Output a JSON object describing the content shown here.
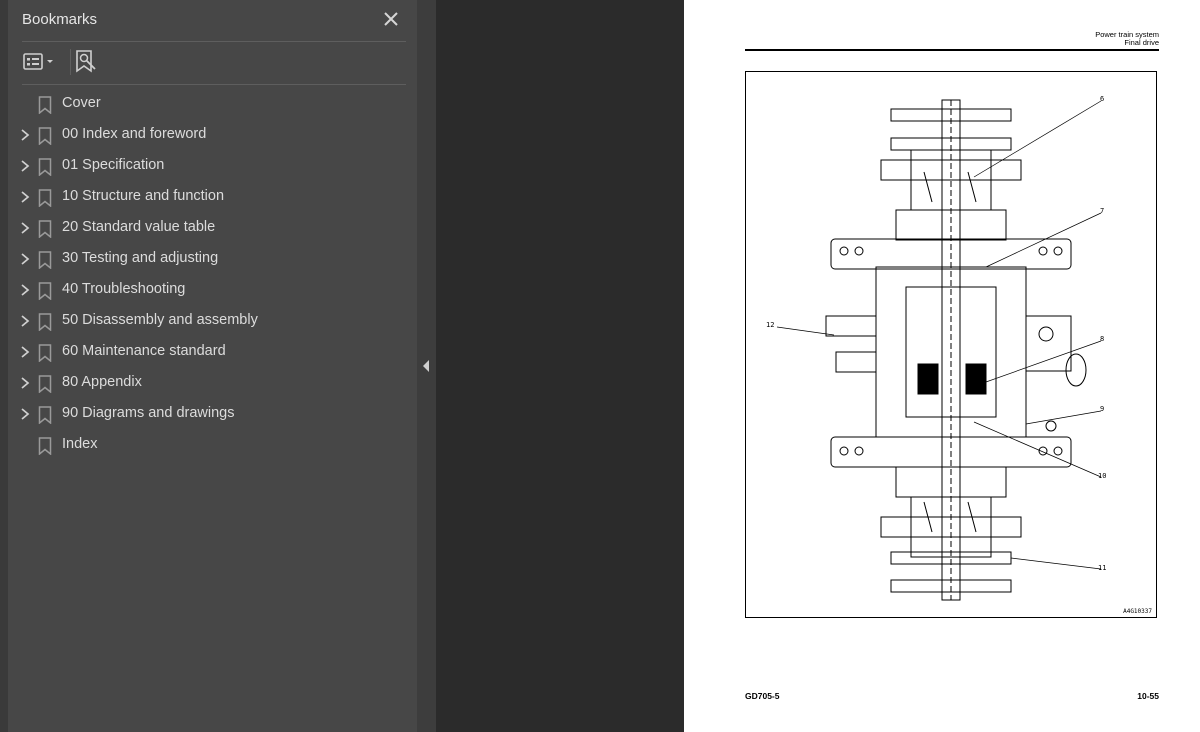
{
  "panel": {
    "title": "Bookmarks",
    "close_icon": "close-icon",
    "toolbar": [
      {
        "icon": "options-menu-icon"
      },
      {
        "icon": "find-bookmark-icon"
      }
    ]
  },
  "bookmarks": [
    {
      "label": "Cover",
      "expandable": false
    },
    {
      "label": "00 Index and foreword",
      "expandable": true
    },
    {
      "label": "01 Specification",
      "expandable": true
    },
    {
      "label": "10 Structure and function",
      "expandable": true
    },
    {
      "label": "20 Standard value table",
      "expandable": true
    },
    {
      "label": "30 Testing and adjusting",
      "expandable": true
    },
    {
      "label": "40 Troubleshooting",
      "expandable": true
    },
    {
      "label": "50 Disassembly and assembly",
      "expandable": true
    },
    {
      "label": "60 Maintenance standard",
      "expandable": true
    },
    {
      "label": "80 Appendix",
      "expandable": true
    },
    {
      "label": "90 Diagrams and drawings",
      "expandable": true
    },
    {
      "label": "Index",
      "expandable": false
    }
  ],
  "page": {
    "header_line1": "Power train system",
    "header_line2": "Final drive",
    "figure": {
      "callouts": [
        "6",
        "7",
        "12",
        "8",
        "9",
        "10",
        "11"
      ],
      "figure_id": "A4G10337"
    },
    "footer_left": "GD705-5",
    "footer_right": "10-55"
  },
  "colors": {
    "panel_bg": "#474747",
    "viewer_bg": "#2b2b2b",
    "text_light": "#dcdcdc",
    "icon_gray": "#9a9a9a"
  }
}
